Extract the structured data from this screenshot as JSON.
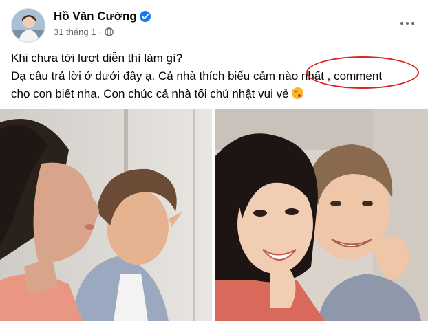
{
  "post": {
    "author": {
      "name": "Hồ Văn Cường",
      "verified": true
    },
    "timestamp": "31 tháng 1",
    "separator": "·",
    "privacy_icon": "globe-icon",
    "more_icon": "more-horizontal-icon",
    "text_lines": [
      "Khi chưa tới lượt diễn thì làm gì?",
      "Dạ câu trả lời ở dưới đây ạ. Cả nhà thích biểu cảm nào nhất , comment",
      "cho con biết nha. Con chúc cả nhà tối chủ nhật vui vẻ"
    ],
    "emoji": "face-blowing-kiss-icon",
    "photos": [
      {
        "name": "photo-profile-pose"
      },
      {
        "name": "photo-funny-selfie"
      }
    ]
  },
  "colors": {
    "verified_blue": "#1877f2",
    "secondary_text": "#65676b",
    "annotation_red": "#e02020"
  }
}
